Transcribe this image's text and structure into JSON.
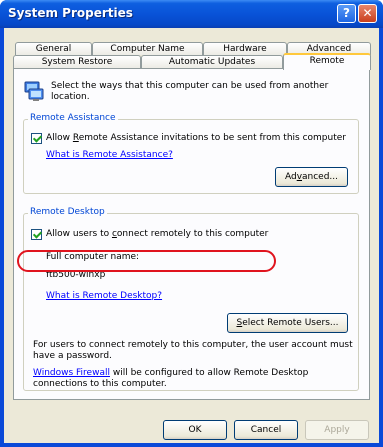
{
  "window": {
    "title": "System Properties"
  },
  "titlebar": {
    "help_glyph": "?",
    "close_glyph": "✕"
  },
  "tabs": {
    "row1": [
      "General",
      "Computer Name",
      "Hardware",
      "Advanced"
    ],
    "row2": [
      "System Restore",
      "Automatic Updates",
      "Remote"
    ],
    "active": "Remote"
  },
  "intro": {
    "text_line1": "Select the ways that this computer can be used from another",
    "text_line2": "location."
  },
  "remote_assistance": {
    "legend": "Remote Assistance",
    "checkbox_pre": "Allow ",
    "checkbox_ul": "R",
    "checkbox_post": "emote Assistance invitations to be sent from this computer",
    "checked": true,
    "link": "What is Remote Assistance?",
    "advanced_pre": "Ad",
    "advanced_ul": "v",
    "advanced_post": "anced..."
  },
  "remote_desktop": {
    "legend": "Remote Desktop",
    "checkbox_pre": "Allow users to ",
    "checkbox_ul": "c",
    "checkbox_post": "onnect remotely to this computer",
    "checked": true,
    "full_name_label": "Full computer name:",
    "computer_name": "ftb500-winxp",
    "link": "What is Remote Desktop?",
    "select_users_pre": "",
    "select_users_ul": "S",
    "select_users_post": "elect Remote Users...",
    "note_line1": "For users to connect remotely to this computer, the user account must",
    "note_line2": "have a password.",
    "firewall_link": "Windows Firewall",
    "firewall_line1_rest": " will be configured to allow Remote Desktop",
    "firewall_line2": "connections to this computer."
  },
  "footer": {
    "ok": "OK",
    "cancel": "Cancel",
    "apply": "Apply"
  },
  "colors": {
    "titlebar": "#0953d8",
    "dialog_bg": "#ece9d8",
    "highlight_ring": "#e0141e",
    "link": "#0000ff",
    "legend": "#0046d5"
  }
}
